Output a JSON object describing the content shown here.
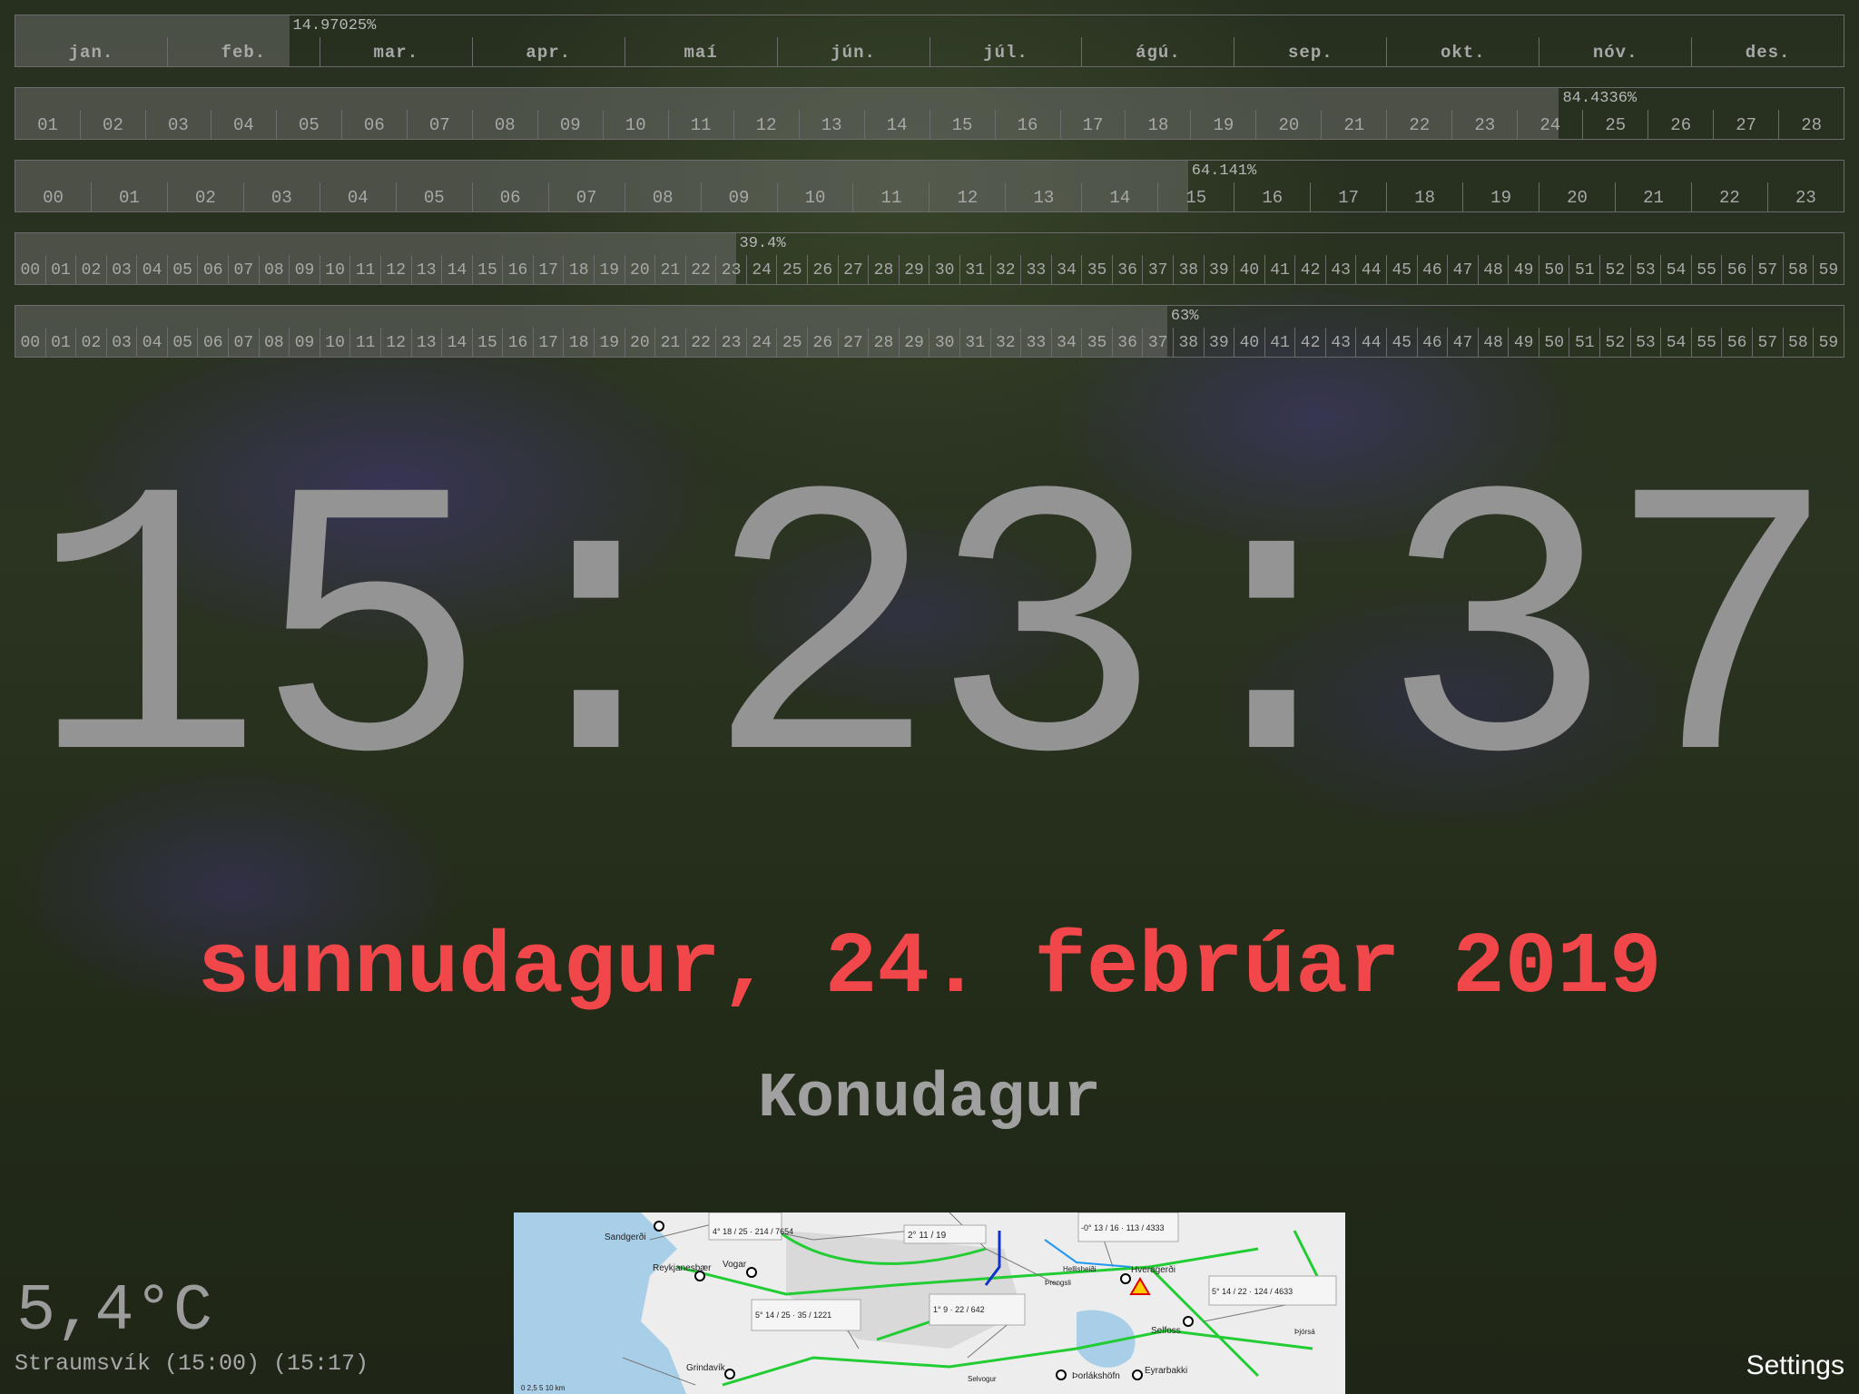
{
  "bars": {
    "year": {
      "percent_label": "14.97025%",
      "fraction": 0.1497025,
      "cells": [
        "jan.",
        "feb.",
        "mar.",
        "apr.",
        "maí",
        "jún.",
        "júl.",
        "ágú.",
        "sep.",
        "okt.",
        "nóv.",
        "des."
      ]
    },
    "month": {
      "percent_label": "84.4336%",
      "fraction": 0.844336,
      "cells": [
        "01",
        "02",
        "03",
        "04",
        "05",
        "06",
        "07",
        "08",
        "09",
        "10",
        "11",
        "12",
        "13",
        "14",
        "15",
        "16",
        "17",
        "18",
        "19",
        "20",
        "21",
        "22",
        "23",
        "24",
        "25",
        "26",
        "27",
        "28"
      ]
    },
    "day": {
      "percent_label": "64.141%",
      "fraction": 0.64141,
      "cells": [
        "00",
        "01",
        "02",
        "03",
        "04",
        "05",
        "06",
        "07",
        "08",
        "09",
        "10",
        "11",
        "12",
        "13",
        "14",
        "15",
        "16",
        "17",
        "18",
        "19",
        "20",
        "21",
        "22",
        "23"
      ]
    },
    "hour": {
      "percent_label": "39.4%",
      "fraction": 0.394,
      "cells": [
        "00",
        "01",
        "02",
        "03",
        "04",
        "05",
        "06",
        "07",
        "08",
        "09",
        "10",
        "11",
        "12",
        "13",
        "14",
        "15",
        "16",
        "17",
        "18",
        "19",
        "20",
        "21",
        "22",
        "23",
        "24",
        "25",
        "26",
        "27",
        "28",
        "29",
        "30",
        "31",
        "32",
        "33",
        "34",
        "35",
        "36",
        "37",
        "38",
        "39",
        "40",
        "41",
        "42",
        "43",
        "44",
        "45",
        "46",
        "47",
        "48",
        "49",
        "50",
        "51",
        "52",
        "53",
        "54",
        "55",
        "56",
        "57",
        "58",
        "59"
      ]
    },
    "minute": {
      "percent_label": "63%",
      "fraction": 0.63,
      "cells": [
        "00",
        "01",
        "02",
        "03",
        "04",
        "05",
        "06",
        "07",
        "08",
        "09",
        "10",
        "11",
        "12",
        "13",
        "14",
        "15",
        "16",
        "17",
        "18",
        "19",
        "20",
        "21",
        "22",
        "23",
        "24",
        "25",
        "26",
        "27",
        "28",
        "29",
        "30",
        "31",
        "32",
        "33",
        "34",
        "35",
        "36",
        "37",
        "38",
        "39",
        "40",
        "41",
        "42",
        "43",
        "44",
        "45",
        "46",
        "47",
        "48",
        "49",
        "50",
        "51",
        "52",
        "53",
        "54",
        "55",
        "56",
        "57",
        "58",
        "59"
      ]
    }
  },
  "clock": {
    "time": "15:23:37"
  },
  "date": {
    "text": "sunnudagur, 24. febrúar 2019"
  },
  "holiday": {
    "text": "Konudagur"
  },
  "weather": {
    "temperature": "5,4°C",
    "station": "Straumsvík (15:00) (15:17)"
  },
  "settings_label": "Settings",
  "map": {
    "places": [
      "Sandgerði",
      "Reykjanesbær",
      "Vogar",
      "Grindavík",
      "Hellisheiði",
      "Þrengsli",
      "Hveragerði",
      "Selfoss",
      "Þjórsá",
      "Eyrarbakki",
      "Þorlákshöfn",
      "Selvogur"
    ],
    "stations": [
      "4° 18 / 25 · 214 / 7654",
      "2° 11 / 19",
      "-0° 13 / 16 · 113 / 4333",
      "5° 14 / 25 · 35 / 1221",
      "1° 9 · 22 / 642",
      "5° 14 / 22 · 124 / 4633"
    ],
    "scale": "0  2,5  5      10 km"
  },
  "colors": {
    "date": "#f2474a",
    "clock": "#949494",
    "bar_fill": "#787878"
  }
}
